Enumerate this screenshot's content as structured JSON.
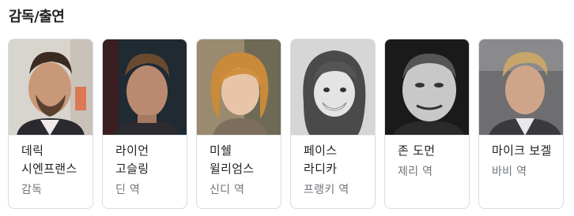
{
  "section": {
    "title": "감독/출연"
  },
  "people": [
    {
      "name": "데릭 시엔프랜스",
      "role": "감독",
      "photo": "person-photo"
    },
    {
      "name": "라이언 고슬링",
      "role": "딘 역",
      "photo": "person-photo"
    },
    {
      "name": "미쉘 윌리엄스",
      "role": "신디 역",
      "photo": "person-photo"
    },
    {
      "name": "페이스 라디카",
      "role": "프랭키 역",
      "photo": "person-photo"
    },
    {
      "name": "존 도먼",
      "role": "제리 역",
      "photo": "person-photo"
    },
    {
      "name": "마이크 보겔",
      "role": "바비 역",
      "photo": "person-photo"
    }
  ]
}
